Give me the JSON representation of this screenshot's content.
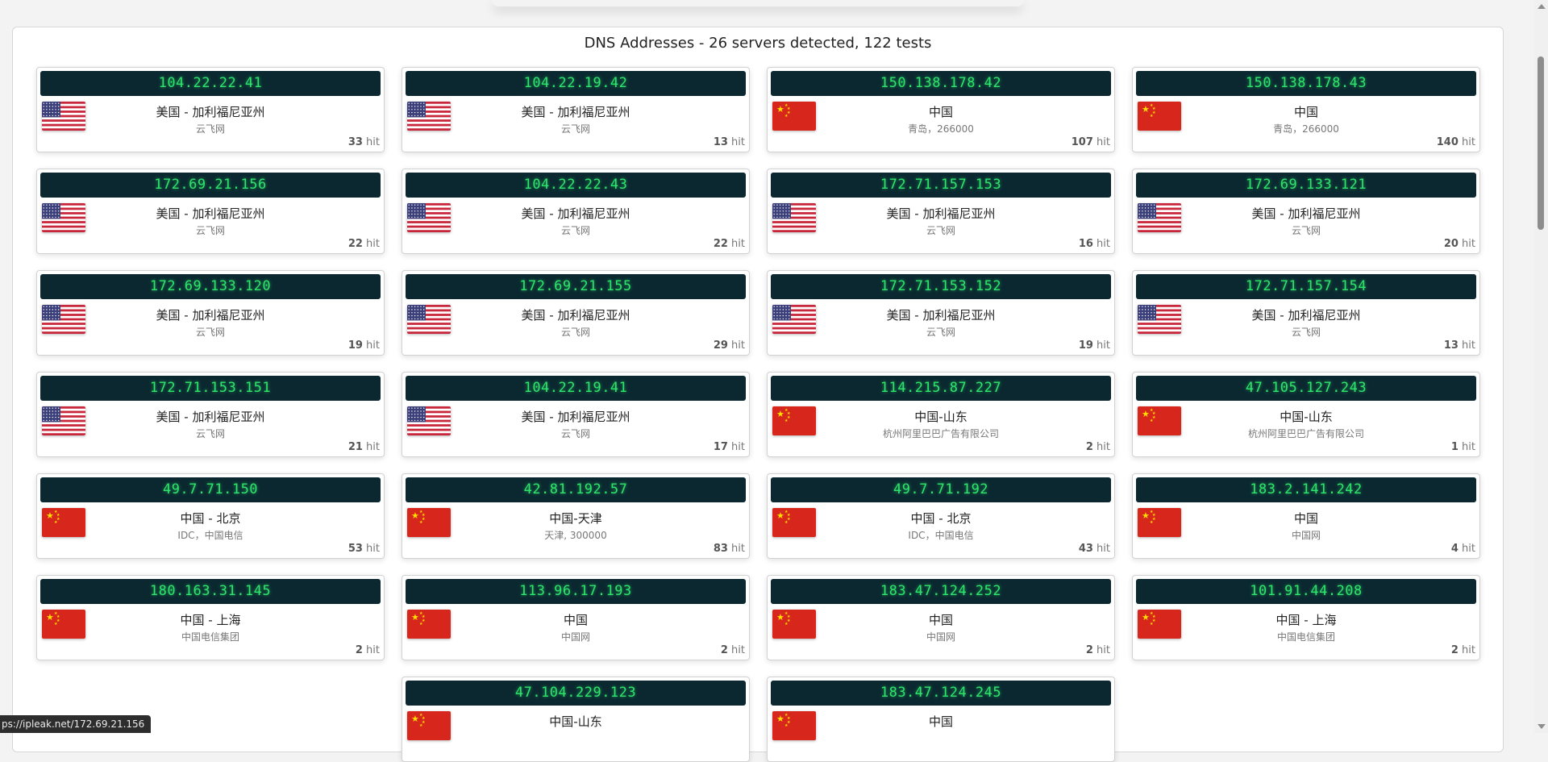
{
  "heading": "DNS Addresses - 26 servers detected, 122 tests",
  "hit_suffix": "hit",
  "status_url": "ps://ipleak.net/172.69.21.156",
  "cards": [
    {
      "ip": "104.22.22.41",
      "flag": "us",
      "location": "美国 - 加利福尼亚州",
      "isp": "云飞网",
      "hits": "33"
    },
    {
      "ip": "104.22.19.42",
      "flag": "us",
      "location": "美国 - 加利福尼亚州",
      "isp": "云飞网",
      "hits": "13"
    },
    {
      "ip": "150.138.178.42",
      "flag": "cn",
      "location": "中国",
      "isp": "青岛，266000",
      "hits": "107"
    },
    {
      "ip": "150.138.178.43",
      "flag": "cn",
      "location": "中国",
      "isp": "青岛，266000",
      "hits": "140"
    },
    {
      "ip": "172.69.21.156",
      "flag": "us",
      "location": "美国 - 加利福尼亚州",
      "isp": "云飞网",
      "hits": "22"
    },
    {
      "ip": "104.22.22.43",
      "flag": "us",
      "location": "美国 - 加利福尼亚州",
      "isp": "云飞网",
      "hits": "22"
    },
    {
      "ip": "172.71.157.153",
      "flag": "us",
      "location": "美国 - 加利福尼亚州",
      "isp": "云飞网",
      "hits": "16"
    },
    {
      "ip": "172.69.133.121",
      "flag": "us",
      "location": "美国 - 加利福尼亚州",
      "isp": "云飞网",
      "hits": "20"
    },
    {
      "ip": "172.69.133.120",
      "flag": "us",
      "location": "美国 - 加利福尼亚州",
      "isp": "云飞网",
      "hits": "19"
    },
    {
      "ip": "172.69.21.155",
      "flag": "us",
      "location": "美国 - 加利福尼亚州",
      "isp": "云飞网",
      "hits": "29"
    },
    {
      "ip": "172.71.153.152",
      "flag": "us",
      "location": "美国 - 加利福尼亚州",
      "isp": "云飞网",
      "hits": "19"
    },
    {
      "ip": "172.71.157.154",
      "flag": "us",
      "location": "美国 - 加利福尼亚州",
      "isp": "云飞网",
      "hits": "13"
    },
    {
      "ip": "172.71.153.151",
      "flag": "us",
      "location": "美国 - 加利福尼亚州",
      "isp": "云飞网",
      "hits": "21"
    },
    {
      "ip": "104.22.19.41",
      "flag": "us",
      "location": "美国 - 加利福尼亚州",
      "isp": "云飞网",
      "hits": "17"
    },
    {
      "ip": "114.215.87.227",
      "flag": "cn",
      "location": "中国-山东",
      "isp": "杭州阿里巴巴广告有限公司",
      "hits": "2"
    },
    {
      "ip": "47.105.127.243",
      "flag": "cn",
      "location": "中国-山东",
      "isp": "杭州阿里巴巴广告有限公司",
      "hits": "1"
    },
    {
      "ip": "49.7.71.150",
      "flag": "cn",
      "location": "中国 - 北京",
      "isp": "IDC，中国电信",
      "hits": "53"
    },
    {
      "ip": "42.81.192.57",
      "flag": "cn",
      "location": "中国-天津",
      "isp": "天津, 300000",
      "hits": "83"
    },
    {
      "ip": "49.7.71.192",
      "flag": "cn",
      "location": "中国 - 北京",
      "isp": "IDC，中国电信",
      "hits": "43"
    },
    {
      "ip": "183.2.141.242",
      "flag": "cn",
      "location": "中国",
      "isp": "中国网",
      "hits": "4"
    },
    {
      "ip": "180.163.31.145",
      "flag": "cn",
      "location": "中国 - 上海",
      "isp": "中国电信集团",
      "hits": "2"
    },
    {
      "ip": "113.96.17.193",
      "flag": "cn",
      "location": "中国",
      "isp": "中国网",
      "hits": "2"
    },
    {
      "ip": "183.47.124.252",
      "flag": "cn",
      "location": "中国",
      "isp": "中国网",
      "hits": "2"
    },
    {
      "ip": "101.91.44.208",
      "flag": "cn",
      "location": "中国 - 上海",
      "isp": "中国电信集团",
      "hits": "2"
    },
    {
      "ip": "47.104.229.123",
      "flag": "cn",
      "location": "中国-山东",
      "isp": "",
      "hits": ""
    },
    {
      "ip": "183.47.124.245",
      "flag": "cn",
      "location": "中国",
      "isp": "",
      "hits": ""
    }
  ]
}
